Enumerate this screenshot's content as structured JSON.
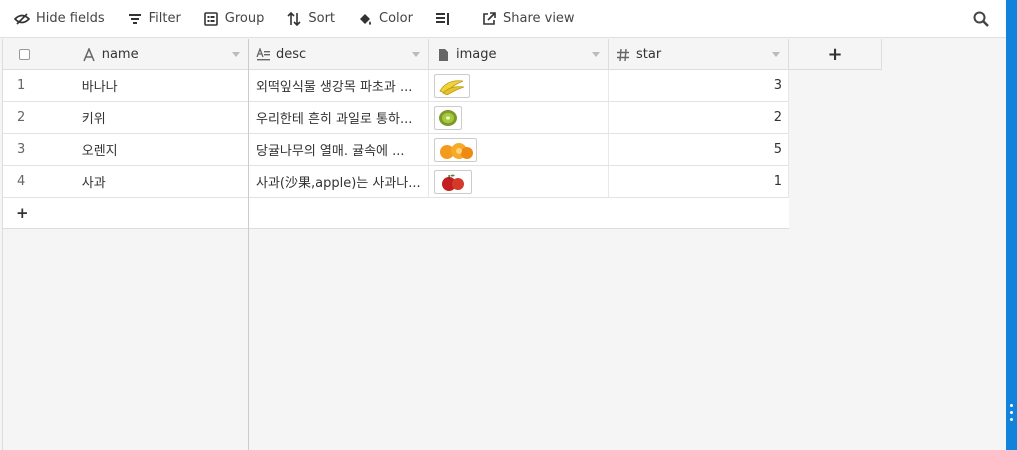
{
  "toolbar": {
    "hide_fields": "Hide fields",
    "filter": "Filter",
    "group": "Group",
    "sort": "Sort",
    "color": "Color",
    "share_view": "Share view",
    "row_height_icon": "row-height-icon",
    "search_icon": "search-icon"
  },
  "columns": {
    "name": "name",
    "desc": "desc",
    "image": "image",
    "star": "star",
    "add": "+"
  },
  "rows": [
    {
      "num": "1",
      "name": "바나나",
      "desc": "외떡잎식물 생강목 파초과 ...",
      "image": "banana",
      "star": "3"
    },
    {
      "num": "2",
      "name": "키위",
      "desc": "우리한테 흔히 과일로 통하...",
      "image": "kiwi",
      "star": "2"
    },
    {
      "num": "3",
      "name": "오렌지",
      "desc": "당귤나무의 열매. 귤속에 ...",
      "image": "orange",
      "star": "5"
    },
    {
      "num": "4",
      "name": "사과",
      "desc": "사과(沙果,apple)는 사과나...",
      "image": "apple",
      "star": "1"
    }
  ],
  "add_row": "+",
  "colors": {
    "accent": "#1283da",
    "header_bg": "#f5f5f5",
    "grid_bg": "#f5f5f5"
  }
}
